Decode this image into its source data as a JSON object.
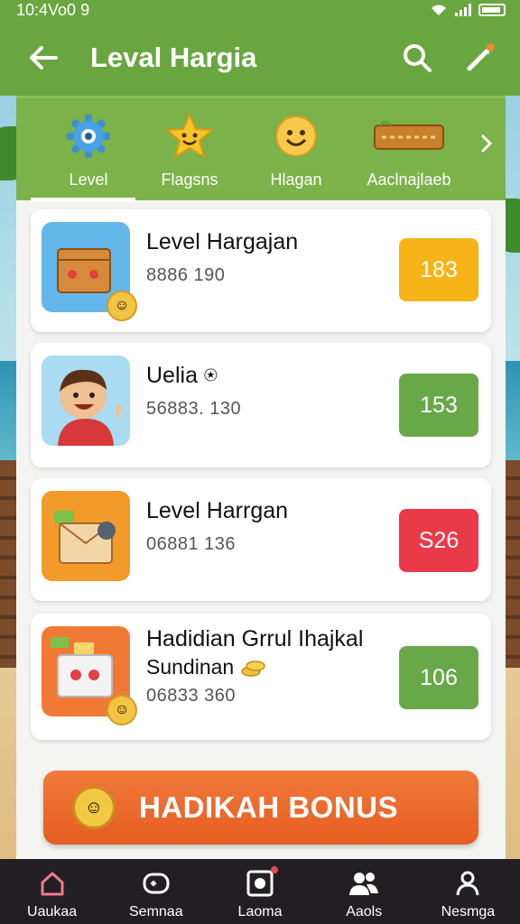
{
  "status_bar": {
    "time": "10:4Vo0 9"
  },
  "app_bar": {
    "title": "Leval Hargia"
  },
  "tabs": [
    {
      "label": "Level",
      "icon": "gear-icon",
      "active": true
    },
    {
      "label": "Flagsns",
      "icon": "star-smile-icon"
    },
    {
      "label": "Hlagan",
      "icon": "smile-face-icon"
    },
    {
      "label": "Aaclnajlaeb",
      "icon": "sign-board-icon"
    }
  ],
  "cards": [
    {
      "title": "Level Hargajan",
      "value": "8886 190",
      "badge": "183",
      "badge_color": "#f6b419",
      "thumb_color": "#63b7ea",
      "icon": "box-icon"
    },
    {
      "title": "Uelia ⍟",
      "value": "56883. 130",
      "badge": "153",
      "badge_color": "#69a849",
      "thumb_color": "#a9dcf2",
      "icon": "person-icon"
    },
    {
      "title": "Level Harrgan",
      "value": "06881 136",
      "badge": "S26",
      "badge_color": "#ea3a4a",
      "thumb_color": "#f29a2a",
      "icon": "box-icon"
    },
    {
      "title": "Hadidian Grrul Ihajkal",
      "subtitle": "Sundinan",
      "value": "06833 360",
      "badge": "106",
      "badge_color": "#69a849",
      "thumb_color": "#f07a35",
      "icon": "gift-box-icon"
    }
  ],
  "bonus_button": {
    "label": "HADIKAH BONUS"
  },
  "bottom_nav": [
    {
      "label": "Uaukaa",
      "icon": "home-icon"
    },
    {
      "label": "Semnaa",
      "icon": "gamepad-icon"
    },
    {
      "label": "Laoma",
      "icon": "badge-icon"
    },
    {
      "label": "Aaols",
      "icon": "users-icon"
    },
    {
      "label": "Nesmga",
      "icon": "profile-icon"
    }
  ]
}
